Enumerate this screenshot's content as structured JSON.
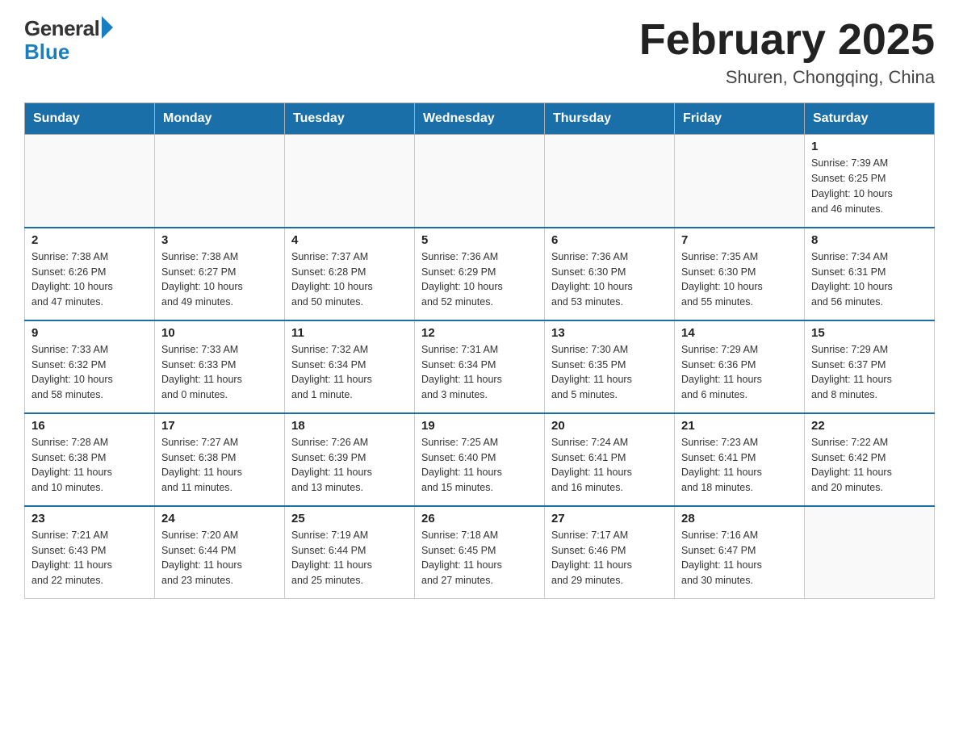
{
  "header": {
    "logo_general": "General",
    "logo_blue": "Blue",
    "month_title": "February 2025",
    "location": "Shuren, Chongqing, China"
  },
  "days_of_week": [
    "Sunday",
    "Monday",
    "Tuesday",
    "Wednesday",
    "Thursday",
    "Friday",
    "Saturday"
  ],
  "weeks": [
    {
      "days": [
        {
          "num": "",
          "info": ""
        },
        {
          "num": "",
          "info": ""
        },
        {
          "num": "",
          "info": ""
        },
        {
          "num": "",
          "info": ""
        },
        {
          "num": "",
          "info": ""
        },
        {
          "num": "",
          "info": ""
        },
        {
          "num": "1",
          "info": "Sunrise: 7:39 AM\nSunset: 6:25 PM\nDaylight: 10 hours\nand 46 minutes."
        }
      ]
    },
    {
      "days": [
        {
          "num": "2",
          "info": "Sunrise: 7:38 AM\nSunset: 6:26 PM\nDaylight: 10 hours\nand 47 minutes."
        },
        {
          "num": "3",
          "info": "Sunrise: 7:38 AM\nSunset: 6:27 PM\nDaylight: 10 hours\nand 49 minutes."
        },
        {
          "num": "4",
          "info": "Sunrise: 7:37 AM\nSunset: 6:28 PM\nDaylight: 10 hours\nand 50 minutes."
        },
        {
          "num": "5",
          "info": "Sunrise: 7:36 AM\nSunset: 6:29 PM\nDaylight: 10 hours\nand 52 minutes."
        },
        {
          "num": "6",
          "info": "Sunrise: 7:36 AM\nSunset: 6:30 PM\nDaylight: 10 hours\nand 53 minutes."
        },
        {
          "num": "7",
          "info": "Sunrise: 7:35 AM\nSunset: 6:30 PM\nDaylight: 10 hours\nand 55 minutes."
        },
        {
          "num": "8",
          "info": "Sunrise: 7:34 AM\nSunset: 6:31 PM\nDaylight: 10 hours\nand 56 minutes."
        }
      ]
    },
    {
      "days": [
        {
          "num": "9",
          "info": "Sunrise: 7:33 AM\nSunset: 6:32 PM\nDaylight: 10 hours\nand 58 minutes."
        },
        {
          "num": "10",
          "info": "Sunrise: 7:33 AM\nSunset: 6:33 PM\nDaylight: 11 hours\nand 0 minutes."
        },
        {
          "num": "11",
          "info": "Sunrise: 7:32 AM\nSunset: 6:34 PM\nDaylight: 11 hours\nand 1 minute."
        },
        {
          "num": "12",
          "info": "Sunrise: 7:31 AM\nSunset: 6:34 PM\nDaylight: 11 hours\nand 3 minutes."
        },
        {
          "num": "13",
          "info": "Sunrise: 7:30 AM\nSunset: 6:35 PM\nDaylight: 11 hours\nand 5 minutes."
        },
        {
          "num": "14",
          "info": "Sunrise: 7:29 AM\nSunset: 6:36 PM\nDaylight: 11 hours\nand 6 minutes."
        },
        {
          "num": "15",
          "info": "Sunrise: 7:29 AM\nSunset: 6:37 PM\nDaylight: 11 hours\nand 8 minutes."
        }
      ]
    },
    {
      "days": [
        {
          "num": "16",
          "info": "Sunrise: 7:28 AM\nSunset: 6:38 PM\nDaylight: 11 hours\nand 10 minutes."
        },
        {
          "num": "17",
          "info": "Sunrise: 7:27 AM\nSunset: 6:38 PM\nDaylight: 11 hours\nand 11 minutes."
        },
        {
          "num": "18",
          "info": "Sunrise: 7:26 AM\nSunset: 6:39 PM\nDaylight: 11 hours\nand 13 minutes."
        },
        {
          "num": "19",
          "info": "Sunrise: 7:25 AM\nSunset: 6:40 PM\nDaylight: 11 hours\nand 15 minutes."
        },
        {
          "num": "20",
          "info": "Sunrise: 7:24 AM\nSunset: 6:41 PM\nDaylight: 11 hours\nand 16 minutes."
        },
        {
          "num": "21",
          "info": "Sunrise: 7:23 AM\nSunset: 6:41 PM\nDaylight: 11 hours\nand 18 minutes."
        },
        {
          "num": "22",
          "info": "Sunrise: 7:22 AM\nSunset: 6:42 PM\nDaylight: 11 hours\nand 20 minutes."
        }
      ]
    },
    {
      "days": [
        {
          "num": "23",
          "info": "Sunrise: 7:21 AM\nSunset: 6:43 PM\nDaylight: 11 hours\nand 22 minutes."
        },
        {
          "num": "24",
          "info": "Sunrise: 7:20 AM\nSunset: 6:44 PM\nDaylight: 11 hours\nand 23 minutes."
        },
        {
          "num": "25",
          "info": "Sunrise: 7:19 AM\nSunset: 6:44 PM\nDaylight: 11 hours\nand 25 minutes."
        },
        {
          "num": "26",
          "info": "Sunrise: 7:18 AM\nSunset: 6:45 PM\nDaylight: 11 hours\nand 27 minutes."
        },
        {
          "num": "27",
          "info": "Sunrise: 7:17 AM\nSunset: 6:46 PM\nDaylight: 11 hours\nand 29 minutes."
        },
        {
          "num": "28",
          "info": "Sunrise: 7:16 AM\nSunset: 6:47 PM\nDaylight: 11 hours\nand 30 minutes."
        },
        {
          "num": "",
          "info": ""
        }
      ]
    }
  ]
}
